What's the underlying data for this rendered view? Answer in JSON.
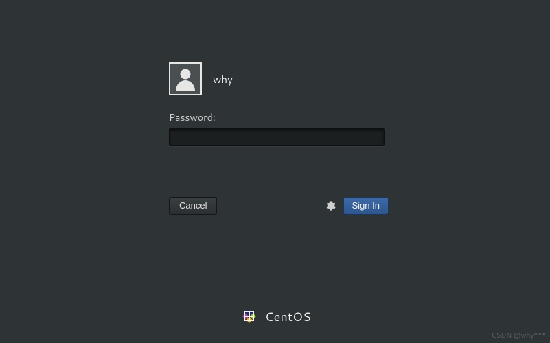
{
  "user": {
    "name": "why"
  },
  "password": {
    "label": "Password:",
    "value": ""
  },
  "buttons": {
    "cancel": "Cancel",
    "signin": "Sign In"
  },
  "brand": {
    "name": "CentOS"
  },
  "watermark": "CSDN @why***"
}
